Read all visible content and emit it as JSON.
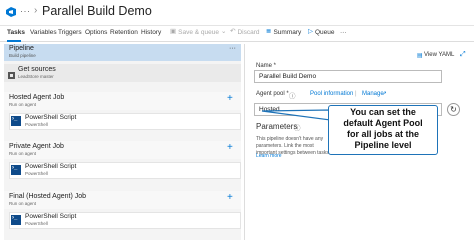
{
  "header": {
    "more": "···",
    "separator": "›",
    "title": "Parallel Build Demo"
  },
  "toolbar": {
    "tabs": [
      "Tasks",
      "Variables",
      "Triggers",
      "Options",
      "Retention",
      "History"
    ],
    "save_queue": "Save & queue",
    "discard": "Discard",
    "summary": "Summary",
    "queue": "Queue",
    "more": "···"
  },
  "pipeline": {
    "title": "Pipeline",
    "subtitle": "Build pipeline",
    "more": "···"
  },
  "get_sources": {
    "title": "Get sources",
    "subtitle": "LeadStore    master"
  },
  "jobs": [
    {
      "title": "Hosted Agent Job",
      "subtitle": "Run on agent",
      "add": "+",
      "task": {
        "title": "PowerShell Script",
        "subtitle": "PowerShell"
      }
    },
    {
      "title": "Private Agent Job",
      "subtitle": "Run on agent",
      "add": "+",
      "task": {
        "title": "PowerShell Script",
        "subtitle": "PowerShell"
      }
    },
    {
      "title": "Final (Hosted Agent) Job",
      "subtitle": "Run on agent",
      "add": "+",
      "task": {
        "title": "PowerShell Script",
        "subtitle": "PowerShell"
      }
    }
  ],
  "details": {
    "view_yaml": "View YAML",
    "name_label": "Name *",
    "name_value": "Parallel Build Demo",
    "agent_pool_label": "Agent pool *",
    "pool_information": "Pool information",
    "manage": "Manage",
    "pool_value": "Hosted",
    "parameters_heading": "Parameters",
    "parameters_text": "This pipeline doesn't have any parameters. Link the most important settings between tasks...",
    "learn_more": "Learn more"
  },
  "callout": {
    "text": "You can set the\ndefault Agent Pool\nfor all jobs at the\nPipeline level"
  },
  "colors": {
    "accent": "#0078d4",
    "selected_row": "#c7dcf0",
    "callout_border": "#1e73b8"
  }
}
